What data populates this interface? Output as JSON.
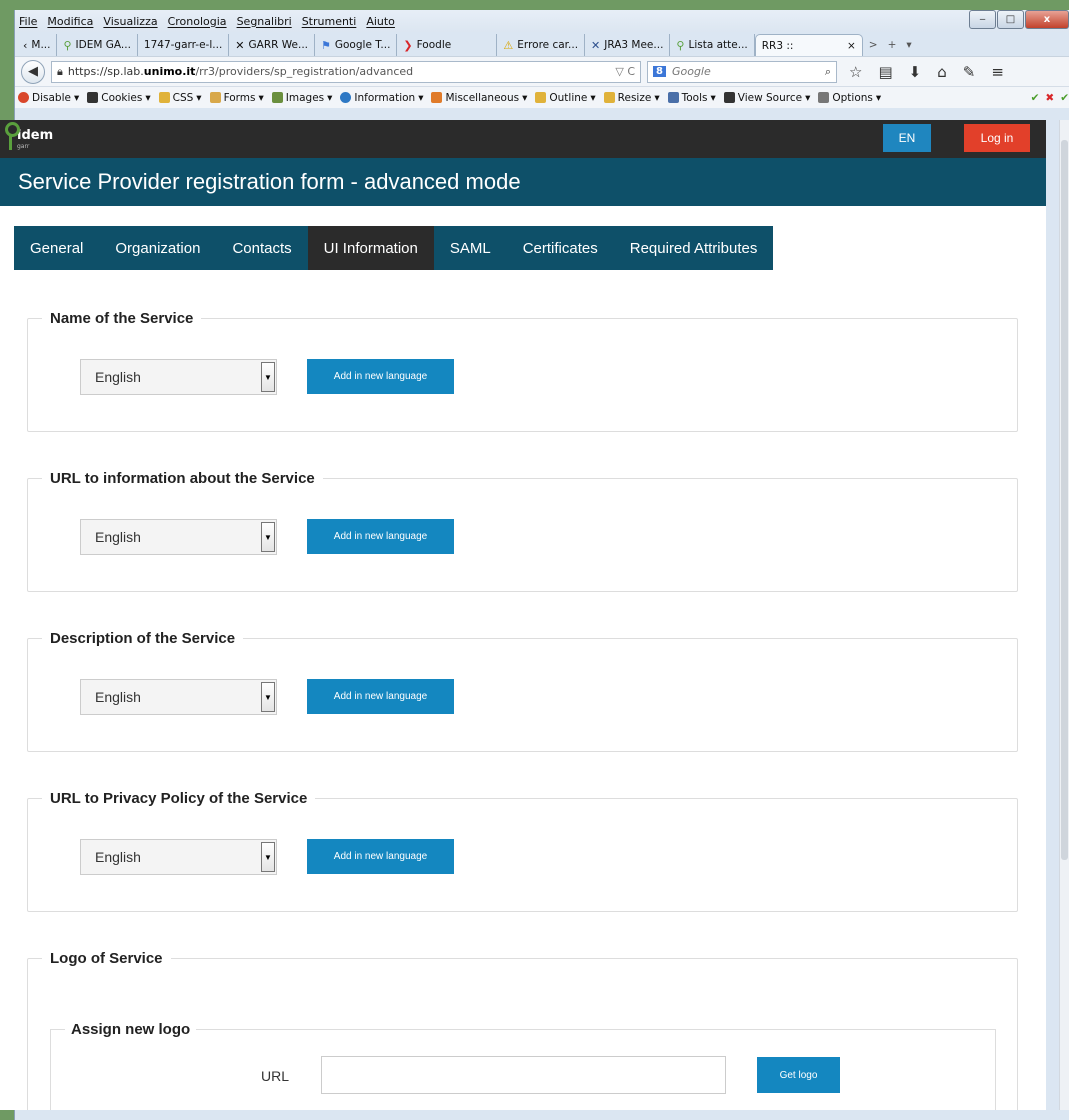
{
  "menubar": {
    "items": [
      "File",
      "Modifica",
      "Visualizza",
      "Cronologia",
      "Segnalibri",
      "Strumenti",
      "Aiuto"
    ]
  },
  "window_controls": {
    "minimize": "‒",
    "maximize": "□",
    "close": "x"
  },
  "browser_tabs": [
    {
      "label": "M...",
      "icon": "chevron-left-icon"
    },
    {
      "label": "IDEM GA...",
      "icon": "idem-key-icon"
    },
    {
      "label": "1747-garr-e-l...",
      "icon": ""
    },
    {
      "label": "GARR We...",
      "icon": "garr-icon"
    },
    {
      "label": "Google T...",
      "icon": "google-translate-icon"
    },
    {
      "label": "Foodle",
      "icon": "foodle-icon"
    },
    {
      "label": "Errore car...",
      "icon": "warning-icon"
    },
    {
      "label": "JRA3 Mee...",
      "icon": "jira-icon"
    },
    {
      "label": "Lista atte...",
      "icon": "idem-key-icon"
    },
    {
      "label": "RR3 ::",
      "icon": "",
      "active": true,
      "close": "×"
    }
  ],
  "tabstrip_extra": {
    "scroll": ">",
    "new_tab": "+",
    "list": "▾"
  },
  "navbar": {
    "url_prefix": "https://sp.lab.",
    "url_domain": "unimo.it",
    "url_rest": "/rr3/providers/sp_registration/advanced",
    "url_right": "▽ C",
    "search_engine": "8",
    "search_placeholder": "Google"
  },
  "webdev_toolbar": [
    {
      "label": "Disable",
      "color": "#d9472b"
    },
    {
      "label": "Cookies",
      "color": "#333333"
    },
    {
      "label": "CSS",
      "color": "#e0b23a"
    },
    {
      "label": "Forms",
      "color": "#d8a84a"
    },
    {
      "label": "Images",
      "color": "#6a8f3e"
    },
    {
      "label": "Information",
      "color": "#2d78c4"
    },
    {
      "label": "Miscellaneous",
      "color": "#e07b2a"
    },
    {
      "label": "Outline",
      "color": "#e0b23a"
    },
    {
      "label": "Resize",
      "color": "#e0b23a"
    },
    {
      "label": "Tools",
      "color": "#4a6fa8"
    },
    {
      "label": "View Source",
      "color": "#333333"
    },
    {
      "label": "Options",
      "color": "#777777"
    }
  ],
  "site": {
    "logo_text": "idem",
    "logo_sub": "garr",
    "lang_button": "EN",
    "login_button": "Log in",
    "page_title": "Service Provider registration form - advanced mode",
    "tabs": [
      "General",
      "Organization",
      "Contacts",
      "UI Information",
      "SAML",
      "Certificates",
      "Required Attributes"
    ],
    "active_tab": "UI Information",
    "sections": [
      {
        "legend": "Name of the Service",
        "select_value": "English",
        "button": "Add in new language"
      },
      {
        "legend": "URL to information about the Service",
        "select_value": "English",
        "button": "Add in new language"
      },
      {
        "legend": "Description of the Service",
        "select_value": "English",
        "button": "Add in new language"
      },
      {
        "legend": "URL to Privacy Policy of the Service",
        "select_value": "English",
        "button": "Add in new language"
      }
    ],
    "logo_section": {
      "legend": "Logo of Service",
      "inner_legend": "Assign new logo",
      "url_label": "URL",
      "url_value": "",
      "button": "Get logo"
    }
  }
}
